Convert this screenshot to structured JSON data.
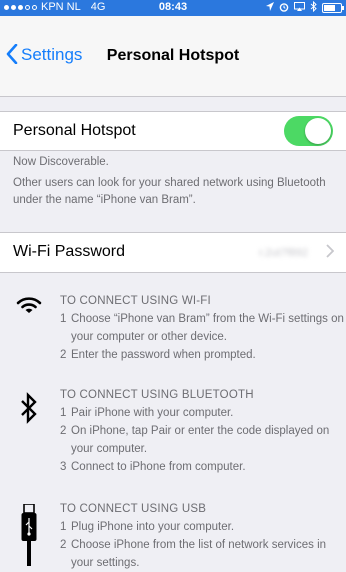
{
  "status_bar": {
    "carrier": "KPN NL",
    "network": "4G",
    "time": "08:43"
  },
  "nav": {
    "back_label": "Settings",
    "title": "Personal Hotspot"
  },
  "hotspot": {
    "label": "Personal Hotspot",
    "enabled": true,
    "accent_color": "#4cd964",
    "footer_line1": "Now Discoverable.",
    "footer_line2": "Other users can look for your shared network using Bluetooth under the name “iPhone van Bram”."
  },
  "wifi_password": {
    "label": "Wi-Fi Password",
    "value": "r.2ut7f892"
  },
  "instructions": [
    {
      "icon": "wifi-icon",
      "heading": "TO CONNECT USING WI-FI",
      "steps": [
        {
          "num": "1",
          "text": "Choose “iPhone van Bram” from the Wi-Fi settings on your computer or other device."
        },
        {
          "num": "2",
          "text": "Enter the password when prompted."
        }
      ]
    },
    {
      "icon": "bluetooth-icon",
      "heading": "TO CONNECT USING BLUETOOTH",
      "steps": [
        {
          "num": "1",
          "text": "Pair iPhone with your computer."
        },
        {
          "num": "2",
          "text": "On iPhone, tap Pair or enter the code displayed on your computer."
        },
        {
          "num": "3",
          "text": "Connect to iPhone from computer."
        }
      ]
    },
    {
      "icon": "usb-cable-icon",
      "heading": "TO CONNECT USING USB",
      "steps": [
        {
          "num": "1",
          "text": "Plug iPhone into your computer."
        },
        {
          "num": "2",
          "text": "Choose iPhone from the list of network services in your settings."
        }
      ]
    }
  ]
}
